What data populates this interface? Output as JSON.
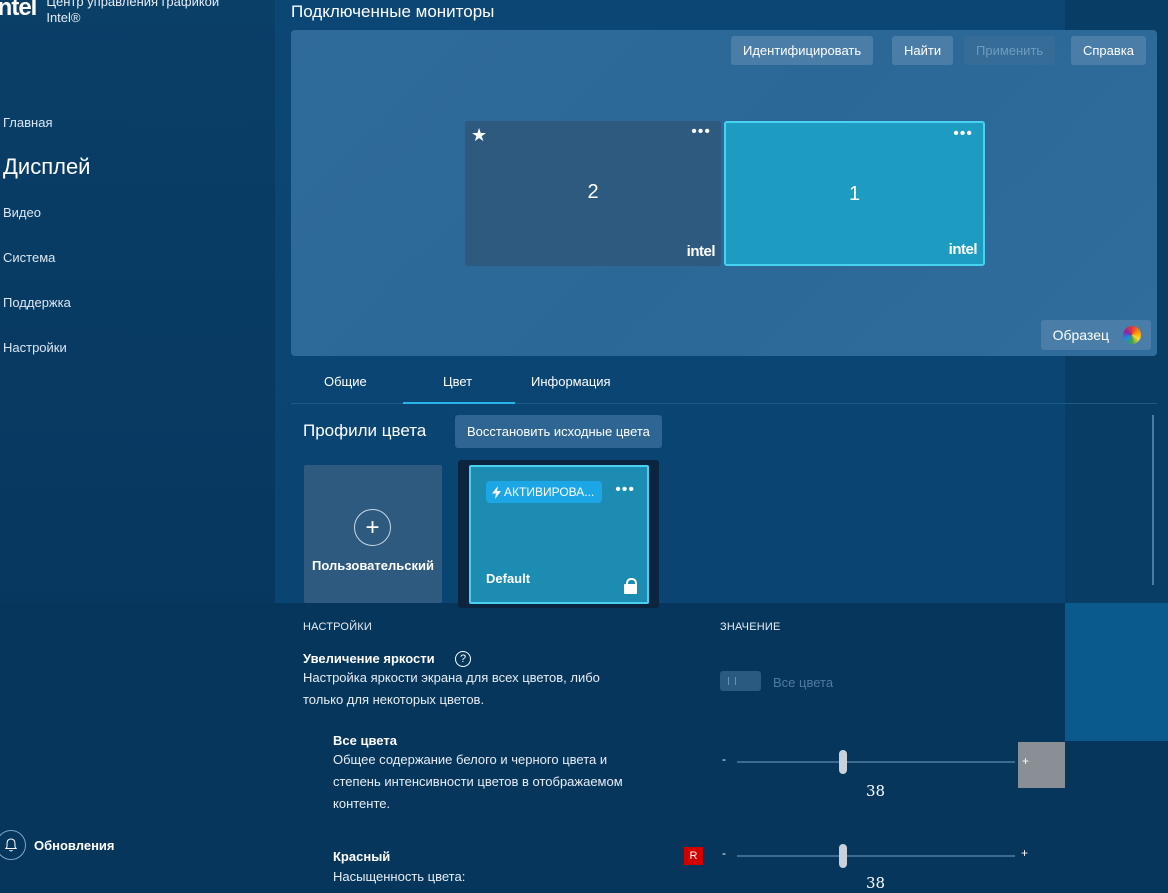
{
  "sidebar": {
    "brand_logo": "intel",
    "brand_title_line1": "Центр управления графикой",
    "brand_title_line2": "Intel®",
    "items": [
      {
        "label": "Главная"
      },
      {
        "label": "Дисплей"
      },
      {
        "label": "Видео"
      },
      {
        "label": "Система"
      },
      {
        "label": "Поддержка"
      },
      {
        "label": "Настройки"
      }
    ],
    "updates_label": "Обновления"
  },
  "monitors": {
    "title": "Подключенные мониторы",
    "toolbar": {
      "identify": "Идентифицировать",
      "find": "Найти",
      "apply": "Применить",
      "help": "Справка"
    },
    "displays": [
      {
        "number": "2",
        "logo": "intel",
        "primary": true
      },
      {
        "number": "1",
        "logo": "intel",
        "selected": true
      }
    ],
    "sample_label": "Образец"
  },
  "tabs": [
    {
      "label": "Общие"
    },
    {
      "label": "Цвет"
    },
    {
      "label": "Информация"
    }
  ],
  "profiles": {
    "title": "Профили цвета",
    "restore_label": "Восстановить исходные цвета",
    "custom_label": "Пользовательский",
    "default_badge": "АКТИВИРОВА...",
    "default_name": "Default"
  },
  "settings": {
    "col_settings": "НАСТРОЙКИ",
    "col_value": "ЗНАЧЕНИЕ",
    "brightness": {
      "title": "Увеличение яркости",
      "desc_line1": "Настройка яркости экрана для всех цветов, либо",
      "desc_line2": "только для некоторых цветов.",
      "toggle_label": "Все цвета"
    },
    "all_colors": {
      "title": "Все цвета",
      "desc_line1": "Общее содержание белого и черного цвета и",
      "desc_line2": "степень интенсивности цветов в отображаемом",
      "desc_line3": "контенте.",
      "minus": "-",
      "plus": "+",
      "value": "38",
      "fraction": 0.38
    },
    "red": {
      "title": "Красный",
      "badge": "R",
      "desc_line1": "Насыщенность цвета:",
      "minus": "-",
      "plus": "+",
      "value": "38",
      "fraction": 0.38
    }
  },
  "colors": {
    "accent": "#28b4e8",
    "selected_monitor": "#1d9bc0",
    "red_badge": "#d40000"
  }
}
